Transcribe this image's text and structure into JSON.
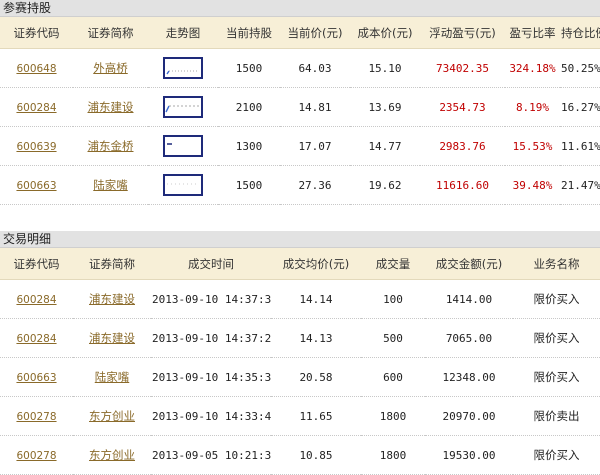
{
  "holdings": {
    "title": "参赛持股",
    "headers": [
      "证券代码",
      "证券简称",
      "走势图",
      "当前持股",
      "当前价(元)",
      "成本价(元)",
      "浮动盈亏(元)",
      "盈亏比率",
      "持仓比例"
    ],
    "rows": [
      {
        "code": "600648",
        "name": "外高桥",
        "shares": "1500",
        "price": "64.03",
        "cost": "15.10",
        "pnl": "73402.35",
        "ratio": "324.18%",
        "weight": "50.25%",
        "trend": "up"
      },
      {
        "code": "600284",
        "name": "浦东建设",
        "shares": "2100",
        "price": "14.81",
        "cost": "13.69",
        "pnl": "2354.73",
        "ratio": "8.19%",
        "weight": "16.27%",
        "trend": "up-dashed"
      },
      {
        "code": "600639",
        "name": "浦东金桥",
        "shares": "1300",
        "price": "17.07",
        "cost": "14.77",
        "pnl": "2983.76",
        "ratio": "15.53%",
        "weight": "11.61%",
        "trend": "flat"
      },
      {
        "code": "600663",
        "name": "陆家嘴",
        "shares": "1500",
        "price": "27.36",
        "cost": "19.62",
        "pnl": "11616.60",
        "ratio": "39.48%",
        "weight": "21.47%",
        "trend": "flat"
      }
    ]
  },
  "trades": {
    "title": "交易明细",
    "headers": [
      "证券代码",
      "证券简称",
      "成交时间",
      "成交均价(元)",
      "成交量",
      "成交金额(元)",
      "业务名称"
    ],
    "rows": [
      {
        "code": "600284",
        "name": "浦东建设",
        "time": "2013-09-10 14:37:30",
        "avg_price": "14.14",
        "volume": "100",
        "amount": "1414.00",
        "type": "限价买入"
      },
      {
        "code": "600284",
        "name": "浦东建设",
        "time": "2013-09-10 14:37:25",
        "avg_price": "14.13",
        "volume": "500",
        "amount": "7065.00",
        "type": "限价买入"
      },
      {
        "code": "600663",
        "name": "陆家嘴",
        "time": "2013-09-10 14:35:35",
        "avg_price": "20.58",
        "volume": "600",
        "amount": "12348.00",
        "type": "限价买入"
      },
      {
        "code": "600278",
        "name": "东方创业",
        "time": "2013-09-10 14:33:40",
        "avg_price": "11.65",
        "volume": "1800",
        "amount": "20970.00",
        "type": "限价卖出"
      },
      {
        "code": "600278",
        "name": "东方创业",
        "time": "2013-09-05 10:21:36",
        "avg_price": "10.85",
        "volume": "1800",
        "amount": "19530.00",
        "type": "限价买入"
      }
    ]
  },
  "colors": {
    "link": "#8a6a2a",
    "loss_profit_red": "#c00000",
    "header_bg": "#f7efd7",
    "section_bg": "#e2e2e2",
    "sparkline_border": "#1e2a7a"
  }
}
